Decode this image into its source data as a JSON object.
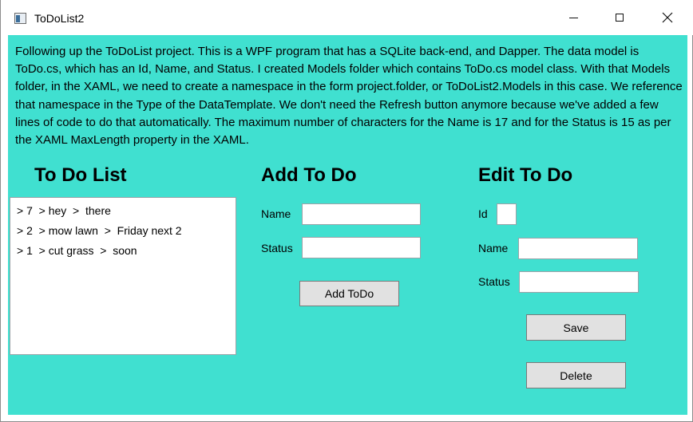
{
  "window": {
    "title": "ToDoList2"
  },
  "description": "Following up the ToDoList project. This is a WPF program that has a SQLite back-end, and Dapper. The data model is ToDo.cs, which has an Id, Name, and Status. I created Models folder which contains ToDo.cs model class. With that Models folder, in the XAML, we need to create a namespace in the form project.folder, or ToDoList2.Models in this case. We reference that namespace in the Type of the DataTemplate. We don't need the Refresh button anymore because we've added a few lines of code to do that automatically. The maximum number of characters for the Name is 17 and for the Status is 15 as per the XAML MaxLength property in the XAML.",
  "todo_list": {
    "heading": "To Do List",
    "items": [
      {
        "text": "> 7  > hey  >  there"
      },
      {
        "text": "> 2  > mow lawn  >  Friday next 2"
      },
      {
        "text": "> 1  > cut grass  >  soon"
      }
    ]
  },
  "add_todo": {
    "heading": "Add To Do",
    "name_label": "Name",
    "name_value": "",
    "status_label": "Status",
    "status_value": "",
    "button_label": "Add ToDo"
  },
  "edit_todo": {
    "heading": "Edit To Do",
    "id_label": "Id",
    "id_value": "",
    "name_label": "Name",
    "name_value": "",
    "status_label": "Status",
    "status_value": "",
    "save_label": "Save",
    "delete_label": "Delete"
  },
  "colors": {
    "background": "#40e0d0",
    "button": "#e1e1e1"
  },
  "icons": [
    "app-icon",
    "minimize-icon",
    "maximize-icon",
    "close-icon"
  ]
}
